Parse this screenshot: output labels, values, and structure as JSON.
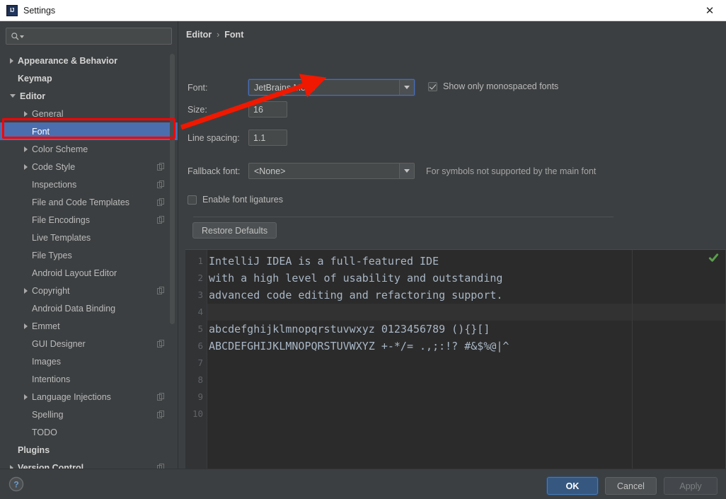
{
  "window": {
    "title": "Settings",
    "logo_icon": "intellij-idea-logo",
    "close_icon": "close-icon"
  },
  "sidebar": {
    "search": {
      "placeholder": "",
      "value": "",
      "icon": "search-icon",
      "dropdown_icon": "chevron-down-icon"
    },
    "items": [
      {
        "label": "Appearance & Behavior",
        "twisty": "collapsed",
        "indent": 0,
        "bold": true,
        "selected": false,
        "copy_icon": false
      },
      {
        "label": "Keymap",
        "twisty": "none",
        "indent": 0,
        "bold": true,
        "selected": false,
        "copy_icon": false
      },
      {
        "label": "Editor",
        "twisty": "expanded",
        "indent": 0,
        "bold": true,
        "selected": false,
        "copy_icon": false
      },
      {
        "label": "General",
        "twisty": "collapsed",
        "indent": 1,
        "bold": false,
        "selected": false,
        "copy_icon": false
      },
      {
        "label": "Font",
        "twisty": "none",
        "indent": 1,
        "bold": false,
        "selected": true,
        "copy_icon": false
      },
      {
        "label": "Color Scheme",
        "twisty": "collapsed",
        "indent": 1,
        "bold": false,
        "selected": false,
        "copy_icon": false
      },
      {
        "label": "Code Style",
        "twisty": "collapsed",
        "indent": 1,
        "bold": false,
        "selected": false,
        "copy_icon": true
      },
      {
        "label": "Inspections",
        "twisty": "none",
        "indent": 1,
        "bold": false,
        "selected": false,
        "copy_icon": true
      },
      {
        "label": "File and Code Templates",
        "twisty": "none",
        "indent": 1,
        "bold": false,
        "selected": false,
        "copy_icon": true
      },
      {
        "label": "File Encodings",
        "twisty": "none",
        "indent": 1,
        "bold": false,
        "selected": false,
        "copy_icon": true
      },
      {
        "label": "Live Templates",
        "twisty": "none",
        "indent": 1,
        "bold": false,
        "selected": false,
        "copy_icon": false
      },
      {
        "label": "File Types",
        "twisty": "none",
        "indent": 1,
        "bold": false,
        "selected": false,
        "copy_icon": false
      },
      {
        "label": "Android Layout Editor",
        "twisty": "none",
        "indent": 1,
        "bold": false,
        "selected": false,
        "copy_icon": false
      },
      {
        "label": "Copyright",
        "twisty": "collapsed",
        "indent": 1,
        "bold": false,
        "selected": false,
        "copy_icon": true
      },
      {
        "label": "Android Data Binding",
        "twisty": "none",
        "indent": 1,
        "bold": false,
        "selected": false,
        "copy_icon": false
      },
      {
        "label": "Emmet",
        "twisty": "collapsed",
        "indent": 1,
        "bold": false,
        "selected": false,
        "copy_icon": false
      },
      {
        "label": "GUI Designer",
        "twisty": "none",
        "indent": 1,
        "bold": false,
        "selected": false,
        "copy_icon": true
      },
      {
        "label": "Images",
        "twisty": "none",
        "indent": 1,
        "bold": false,
        "selected": false,
        "copy_icon": false
      },
      {
        "label": "Intentions",
        "twisty": "none",
        "indent": 1,
        "bold": false,
        "selected": false,
        "copy_icon": false
      },
      {
        "label": "Language Injections",
        "twisty": "collapsed",
        "indent": 1,
        "bold": false,
        "selected": false,
        "copy_icon": true
      },
      {
        "label": "Spelling",
        "twisty": "none",
        "indent": 1,
        "bold": false,
        "selected": false,
        "copy_icon": true
      },
      {
        "label": "TODO",
        "twisty": "none",
        "indent": 1,
        "bold": false,
        "selected": false,
        "copy_icon": false
      },
      {
        "label": "Plugins",
        "twisty": "none",
        "indent": 0,
        "bold": true,
        "selected": false,
        "copy_icon": false
      },
      {
        "label": "Version Control",
        "twisty": "collapsed",
        "indent": 0,
        "bold": true,
        "selected": false,
        "copy_icon": true
      }
    ]
  },
  "breadcrumb": {
    "root": "Editor",
    "separator": "›",
    "current": "Font"
  },
  "form": {
    "font_label": "Font:",
    "font_value": "JetBrains Mono",
    "size_label": "Size:",
    "size_value": "16",
    "line_spacing_label": "Line spacing:",
    "line_spacing_value": "1.1",
    "fallback_label": "Fallback font:",
    "fallback_value": "<None>",
    "fallback_hint": "For symbols not supported by the main font",
    "monospaced_checkbox_label": "Show only monospaced fonts",
    "monospaced_checked": true,
    "ligatures_checkbox_label": "Enable font ligatures",
    "ligatures_checked": false,
    "restore_defaults_label": "Restore Defaults"
  },
  "preview": {
    "check_icon": "green-check-icon",
    "line_numbers": [
      "1",
      "2",
      "3",
      "4",
      "5",
      "6",
      "7",
      "8",
      "9",
      "10"
    ],
    "lines": [
      "IntelliJ IDEA is a full-featured IDE",
      "with a high level of usability and outstanding",
      "advanced code editing and refactoring support.",
      "",
      "abcdefghijklmnopqrstuvwxyz 0123456789 (){}[]",
      "ABCDEFGHIJKLMNOPQRSTUVWXYZ +-*/= .,;:!? #&$%@|^",
      "",
      "",
      "",
      ""
    ]
  },
  "footer": {
    "help_icon": "help-question-icon",
    "ok_label": "OK",
    "cancel_label": "Cancel",
    "apply_label": "Apply"
  },
  "annotation": {
    "highlight_color": "#ff0000",
    "arrow_color": "#f01800"
  },
  "colors": {
    "dialog_bg": "#3c3f41",
    "editor_bg": "#2b2b2b",
    "selection_blue": "#4b6eaf",
    "ok_button": "#365880",
    "code_text": "#a9b7c6"
  }
}
